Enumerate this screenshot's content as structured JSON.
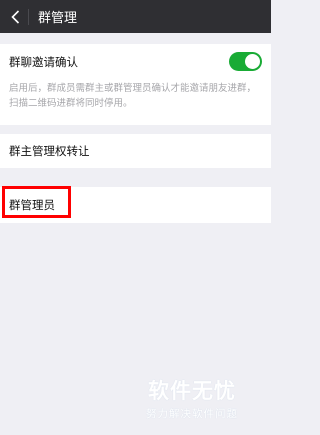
{
  "topbar": {
    "title": "群管理",
    "back_icon": "chevron-left-icon"
  },
  "invite_confirm": {
    "label": "群聊邀请确认",
    "enabled": true,
    "description": "启用后，群成员需群主或群管理员确认才能邀请朋友进群，扫描二维码进群将同时停用。"
  },
  "transfer_ownership": {
    "label": "群主管理权转让"
  },
  "group_admins": {
    "label": "群管理员"
  },
  "watermark": {
    "main": "软件无忧",
    "sub": "努力解决软件问题"
  },
  "colors": {
    "topbar": "#2f2f33",
    "toggle_on": "#19ab35",
    "highlight": "#ff0000",
    "background": "#efeff4"
  }
}
